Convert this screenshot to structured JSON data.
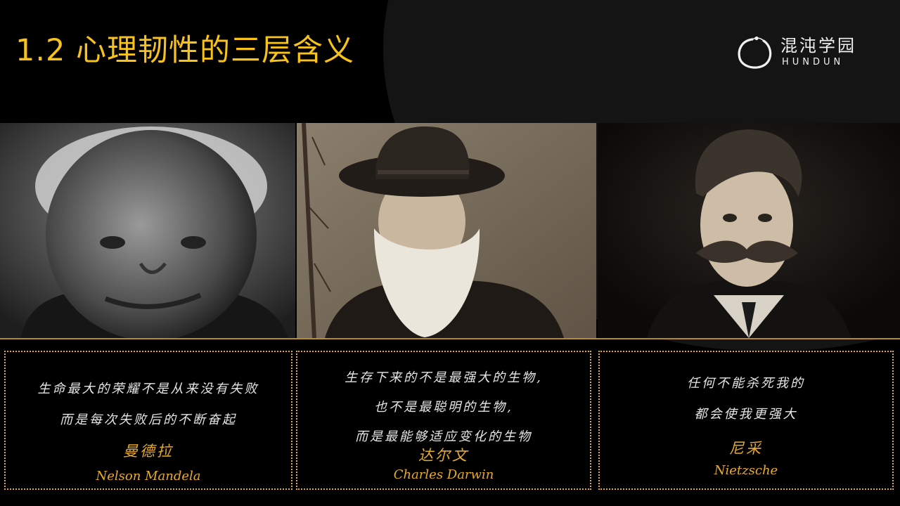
{
  "slide": {
    "title": "1.2 心理韧性的三层含义",
    "colors": {
      "accent": "#f7c21b",
      "border": "#e6ab2b",
      "background": "#000000"
    }
  },
  "logo": {
    "cn": "混沌学园",
    "en": "HUNDUN",
    "icon": "enso-circle-icon"
  },
  "cards": [
    {
      "quote": [
        "生命最大的荣耀不是从来没有失败",
        "而是每次失败后的不断奋起"
      ],
      "name_cn": "曼德拉",
      "name_en": "Nelson Mandela"
    },
    {
      "quote": [
        "生存下来的不是最强大的生物,",
        "也不是最聪明的生物,",
        "而是最能够适应变化的生物"
      ],
      "name_cn": "达尔文",
      "name_en": "Charles Darwin"
    },
    {
      "quote": [
        "任何不能杀死我的",
        "都会使我更强大"
      ],
      "name_cn": "尼采",
      "name_en": "Nietzsche"
    }
  ]
}
